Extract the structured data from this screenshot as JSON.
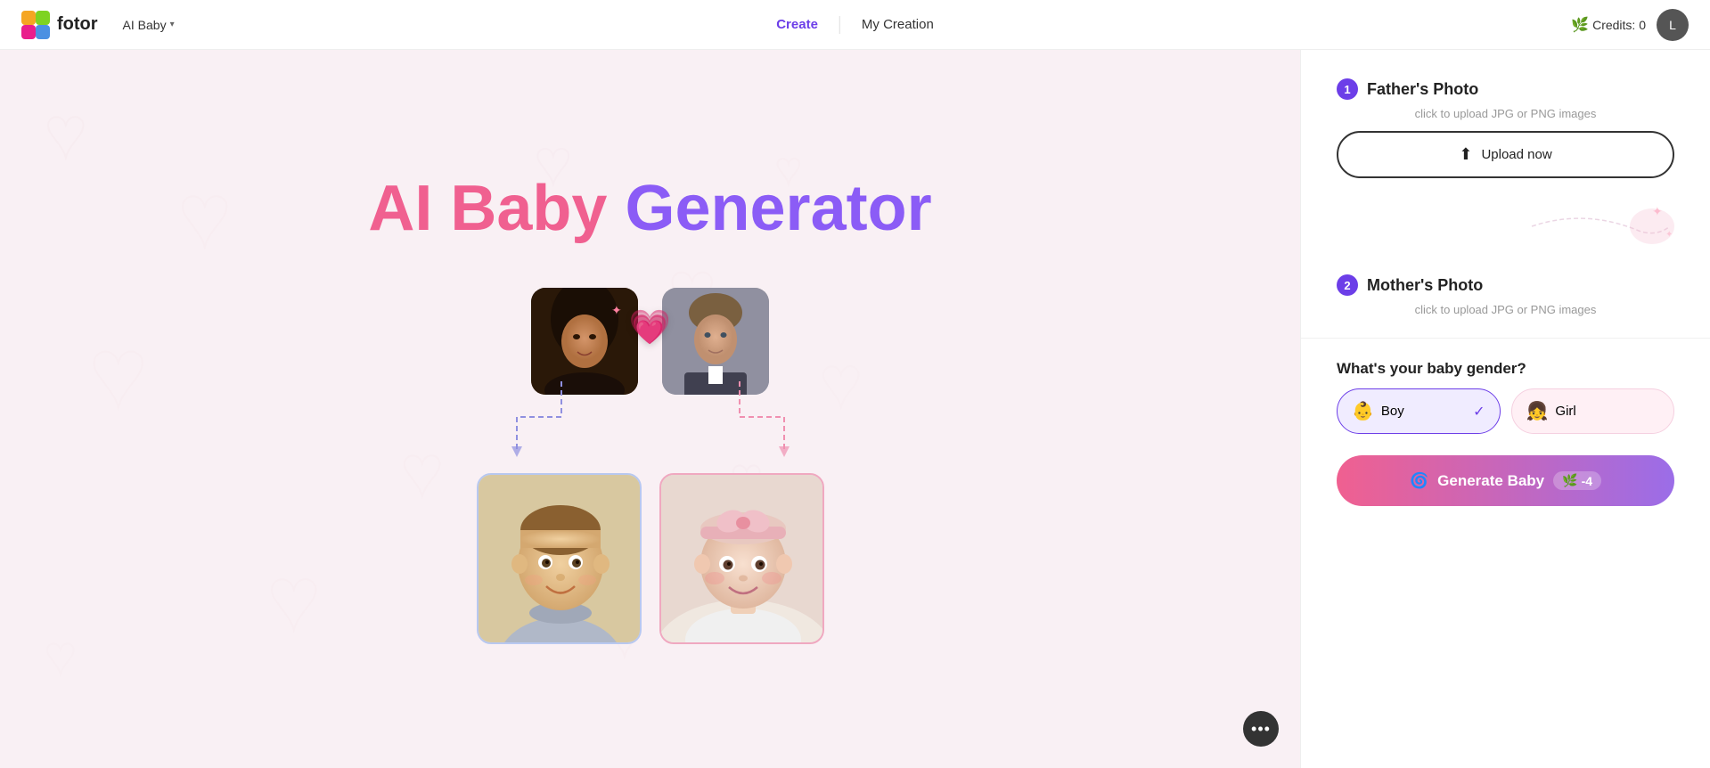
{
  "header": {
    "logo_text": "fotor",
    "ai_baby_label": "AI Baby",
    "nav_create": "Create",
    "nav_my_creation": "My Creation",
    "credits_label": "Credits: 0"
  },
  "left_panel": {
    "title_part1": "AI Baby",
    "title_part2": "Generator"
  },
  "right_panel": {
    "step1_number": "1",
    "step1_title": "Father's Photo",
    "step1_hint": "click to upload JPG or PNG images",
    "upload_btn_label": "Upload now",
    "step2_number": "2",
    "step2_title": "Mother's Photo",
    "step2_hint": "click to upload JPG or PNG images",
    "gender_title": "What's your baby gender?",
    "boy_label": "Boy",
    "girl_label": "Girl",
    "generate_btn_label": "Generate Baby",
    "credits_cost": "-4"
  }
}
